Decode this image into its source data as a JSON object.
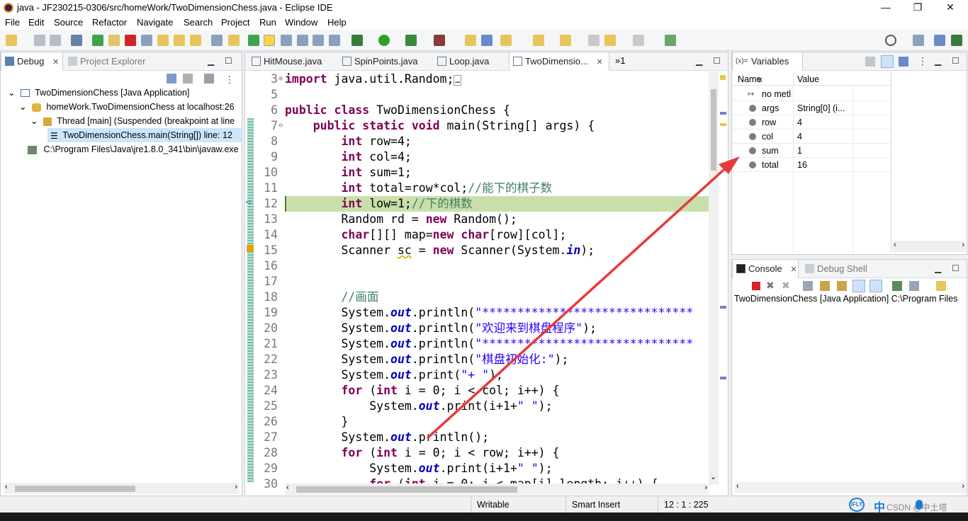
{
  "window": {
    "title": "java - JF230215-0306/src/homeWork/TwoDimensionChess.java - Eclipse IDE",
    "minimize": "—",
    "restore": "❐",
    "close": "✕"
  },
  "menu": [
    "File",
    "Edit",
    "Source",
    "Refactor",
    "Navigate",
    "Search",
    "Project",
    "Run",
    "Window",
    "Help"
  ],
  "debug_panel": {
    "tabs": [
      "Debug",
      "Project Explorer"
    ],
    "tree": [
      "TwoDimensionChess [Java Application]",
      "homeWork.TwoDimensionChess at localhost:26",
      "Thread [main] (Suspended (breakpoint at line",
      "TwoDimensionChess.main(String[]) line: 12",
      "C:\\Program Files\\Java\\jre1.8.0_341\\bin\\javaw.exe"
    ]
  },
  "editor": {
    "tabs": [
      "HitMouse.java",
      "SpinPoints.java",
      "Loop.java",
      "TwoDimensio...",
      "»1"
    ],
    "line_numbers": [
      "3",
      "5",
      "6",
      "7",
      "8",
      "9",
      "10",
      "11",
      "12",
      "13",
      "14",
      "15",
      "16",
      "17",
      "18",
      "19",
      "20",
      "21",
      "22",
      "23",
      "24",
      "25",
      "26",
      "27",
      "28",
      "29",
      "30"
    ],
    "current_line": 12
  },
  "variables": {
    "tab": "Variables",
    "headers": [
      "Name",
      "Value"
    ],
    "rows": [
      {
        "name": "no metl",
        "value": ""
      },
      {
        "name": "args",
        "value": "String[0]  (i..."
      },
      {
        "name": "row",
        "value": "4"
      },
      {
        "name": "col",
        "value": "4"
      },
      {
        "name": "sum",
        "value": "1"
      },
      {
        "name": "total",
        "value": "16"
      }
    ]
  },
  "console": {
    "tabs": [
      "Console",
      "Debug Shell"
    ],
    "description": "TwoDimensionChess [Java Application] C:\\Program Files"
  },
  "status": {
    "writable": "Writable",
    "insert_mode": "Smart Insert",
    "position": "12 : 1 : 225",
    "ime": "中",
    "watermark": "CSDN @中土塔"
  },
  "colors": {
    "keyword": "#7f0055",
    "string": "#2a00ff",
    "comment": "#3f7f5f",
    "current_line": "#c9dfaa",
    "arrow": "#e83a3a"
  }
}
